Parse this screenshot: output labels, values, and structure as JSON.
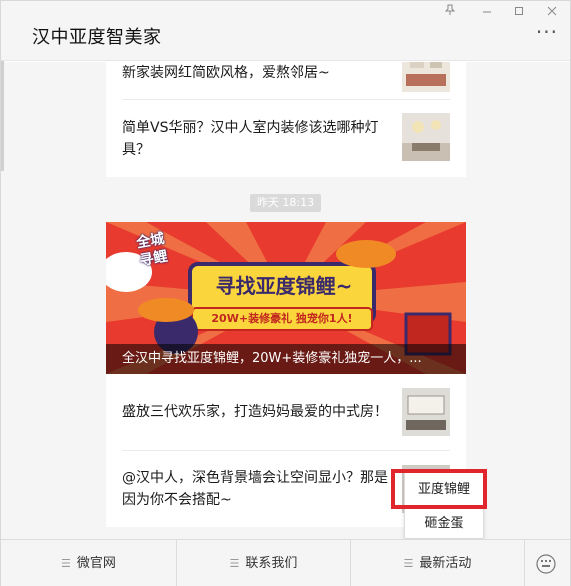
{
  "window": {
    "title": "汉中亚度智美家",
    "more_label": "···"
  },
  "articles_top": [
    {
      "text": "新家装网红简欧风格，爱熬邻居~"
    },
    {
      "text": "简单VS华丽？汉中人室内装修该选哪种灯具？"
    }
  ],
  "timestamp": "昨天 18:13",
  "banner": {
    "badge_line1": "全城",
    "badge_line2": "寻鲤",
    "headline": "寻找亚度锦鲤~",
    "subline": "20W+装修豪礼 独宠你1人!",
    "caption": "全汉中寻找亚度锦鲤，20W+装修豪礼独宠一人，..."
  },
  "articles_bottom": [
    {
      "text": "盛放三代欢乐家，打造妈妈最爱的中式房！"
    },
    {
      "text": "@汉中人，深色背景墙会让空间显小？那是因为你不会搭配~"
    }
  ],
  "popup_menu": {
    "items": [
      "亚度锦鲤",
      "砸金蛋"
    ]
  },
  "bottom_menu": {
    "items": [
      "微官网",
      "联系我们",
      "最新活动"
    ]
  },
  "colors": {
    "highlight": "#e0262d",
    "banner_red": "#e83a2e",
    "banner_yellow": "#ffd43b"
  }
}
